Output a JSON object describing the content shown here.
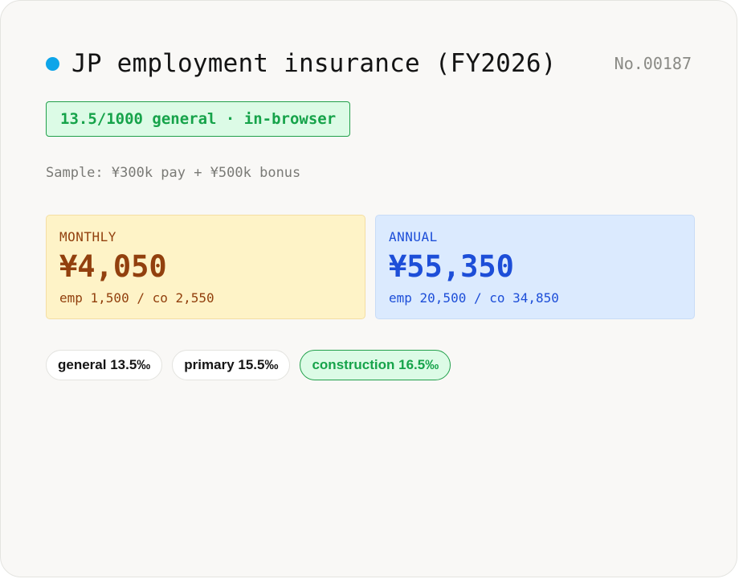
{
  "header": {
    "title": "JP employment insurance (FY2026)",
    "serial": "No.00187",
    "status_color": "#0ea5e9"
  },
  "badge": {
    "label": "13.5/1000 general · in-browser"
  },
  "sample": {
    "text": "Sample: ¥300k pay + ¥500k bonus"
  },
  "stats": {
    "monthly": {
      "label": "MONTHLY",
      "value": "¥4,050",
      "detail": "emp 1,500 / co 2,550",
      "color": "#92400e"
    },
    "annual": {
      "label": "ANNUAL",
      "value": "¥55,350",
      "detail": "emp 20,500 / co 34,850",
      "color": "#1d4ed8"
    }
  },
  "rate_options": [
    {
      "label": "general 13.5‰",
      "selected": false
    },
    {
      "label": "primary 15.5‰",
      "selected": false
    },
    {
      "label": "construction 16.5‰",
      "selected": true
    }
  ],
  "accent_color": "#16a34a"
}
